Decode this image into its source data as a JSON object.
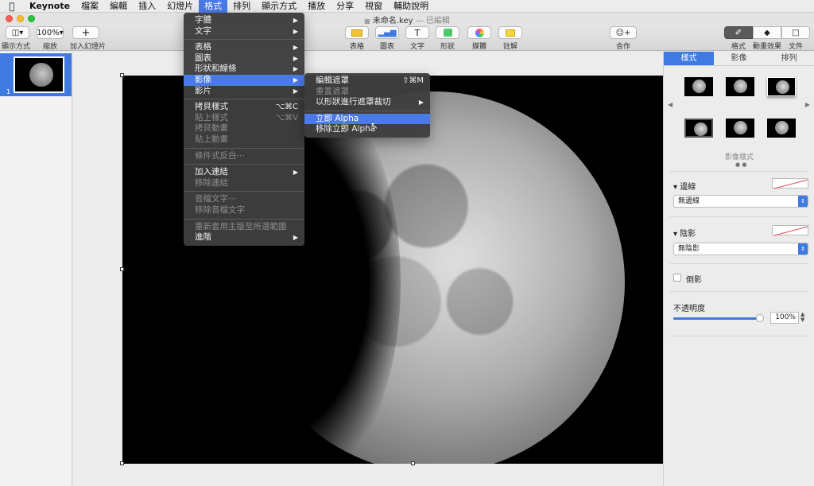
{
  "menubar": {
    "app": "Keynote",
    "items": [
      "檔案",
      "編輯",
      "插入",
      "幻燈片",
      "格式",
      "排列",
      "顯示方式",
      "播放",
      "分享",
      "視窗",
      "輔助說明"
    ],
    "active_index": 4
  },
  "window": {
    "title": "未命名.key",
    "subtitle": "— 已編輯"
  },
  "toolbar": {
    "view_label": "顯示方式",
    "zoom_value": "100%",
    "zoom_label": "縮放",
    "add_slide_label": "加入幻燈片",
    "table_label": "表格",
    "chart_label": "圖表",
    "text_label": "文字",
    "shape_label": "形狀",
    "media_label": "媒體",
    "comment_label": "註解",
    "collaborate_label": "合作",
    "format_label": "格式",
    "animate_label": "動畫效果",
    "document_label": "文件"
  },
  "navigator": {
    "slide_number": "1"
  },
  "format_menu": {
    "items": [
      {
        "label": "字體",
        "submenu": true
      },
      {
        "label": "文字",
        "submenu": true
      },
      {
        "sep": true
      },
      {
        "label": "表格",
        "submenu": true
      },
      {
        "label": "圖表",
        "submenu": true
      },
      {
        "label": "形狀和線條",
        "submenu": true
      },
      {
        "label": "影像",
        "submenu": true,
        "highlight": true
      },
      {
        "label": "影片",
        "submenu": true
      },
      {
        "sep": true
      },
      {
        "label": "拷貝樣式",
        "shortcut": "⌥⌘C"
      },
      {
        "label": "貼上樣式",
        "shortcut": "⌥⌘V",
        "disabled": true
      },
      {
        "label": "拷貝動畫",
        "disabled": true
      },
      {
        "label": "貼上動畫",
        "disabled": true
      },
      {
        "sep": true
      },
      {
        "label": "條件式反白⋯",
        "disabled": true
      },
      {
        "sep": true
      },
      {
        "label": "加入連結",
        "submenu": true
      },
      {
        "label": "移除連結",
        "disabled": true
      },
      {
        "sep": true
      },
      {
        "label": "音檔文字⋯",
        "disabled": true
      },
      {
        "label": "移除音檔文字",
        "disabled": true
      },
      {
        "sep": true
      },
      {
        "label": "重新套用主版至所選範圍",
        "disabled": true
      },
      {
        "label": "進階",
        "submenu": true
      }
    ]
  },
  "image_submenu": {
    "items": [
      {
        "label": "編輯遮罩",
        "shortcut": "⇧⌘M"
      },
      {
        "label": "重置遮罩",
        "disabled": true
      },
      {
        "label": "以形狀進行遮罩裁切",
        "submenu": true
      },
      {
        "sep": true
      },
      {
        "label": "立即 Alpha",
        "highlight": true
      },
      {
        "label": "移除立即 Alpha"
      }
    ]
  },
  "inspector": {
    "tabs": [
      "樣式",
      "影像",
      "排列"
    ],
    "active_tab": 0,
    "styles_caption": "影像樣式",
    "border_title": "邊線",
    "border_value": "無邊線",
    "shadow_title": "陰影",
    "shadow_value": "無陰影",
    "reflection_label": "倒影",
    "opacity_title": "不透明度",
    "opacity_value": "100%",
    "opacity_level": 1.0
  },
  "colors": {
    "accent": "#3f7ae0",
    "menu_bg": "#3e3e3e",
    "highlight": "#4a7ae6"
  }
}
